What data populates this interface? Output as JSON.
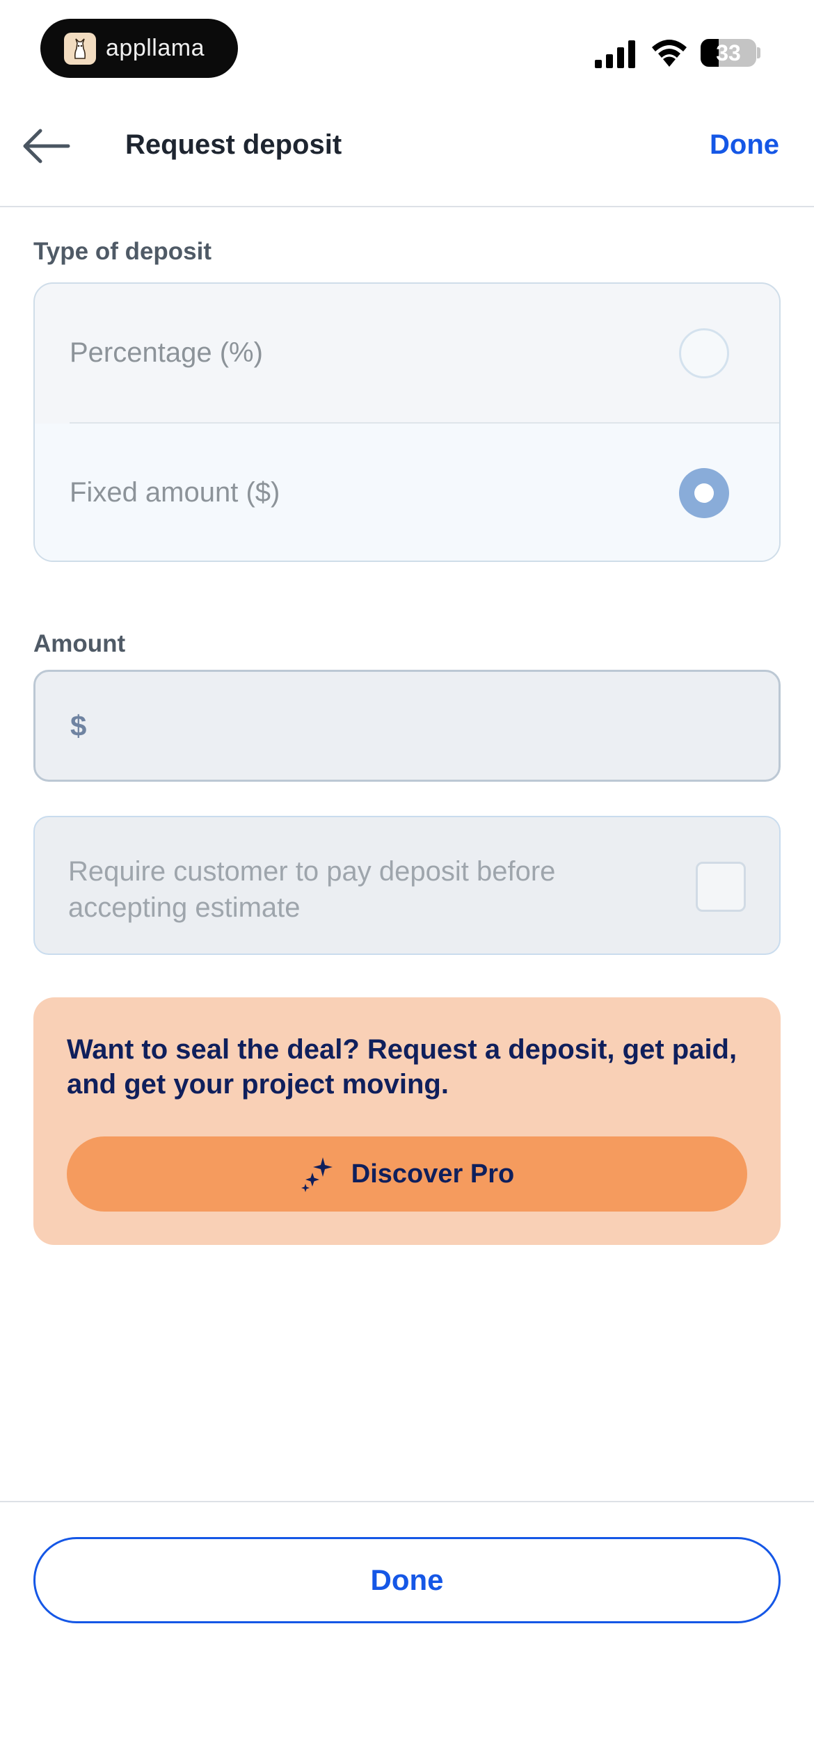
{
  "status_bar": {
    "app_pill_label": "appllama",
    "battery_level": "33",
    "battery_fraction": 0.33
  },
  "header": {
    "title": "Request deposit",
    "done_label": "Done"
  },
  "deposit_type": {
    "label": "Type of deposit",
    "options": [
      {
        "label": "Percentage (%)",
        "selected": false
      },
      {
        "label": "Fixed amount ($)",
        "selected": true
      }
    ]
  },
  "amount": {
    "label": "Amount",
    "prefix": "$",
    "value": ""
  },
  "require_payment": {
    "label": "Require customer to pay deposit before accepting estimate",
    "checked": false
  },
  "promo": {
    "message": "Want to seal the deal? Request a deposit, get paid, and get your project moving.",
    "button_label": "Discover Pro",
    "button_icon": "sparkles-icon"
  },
  "footer": {
    "done_label": "Done"
  },
  "colors": {
    "accent": "#1557e6",
    "promo_bg": "#f9d0b6",
    "promo_button": "#f59b5e",
    "promo_text": "#0f1f5c",
    "radio_selected": "#89acd9"
  }
}
